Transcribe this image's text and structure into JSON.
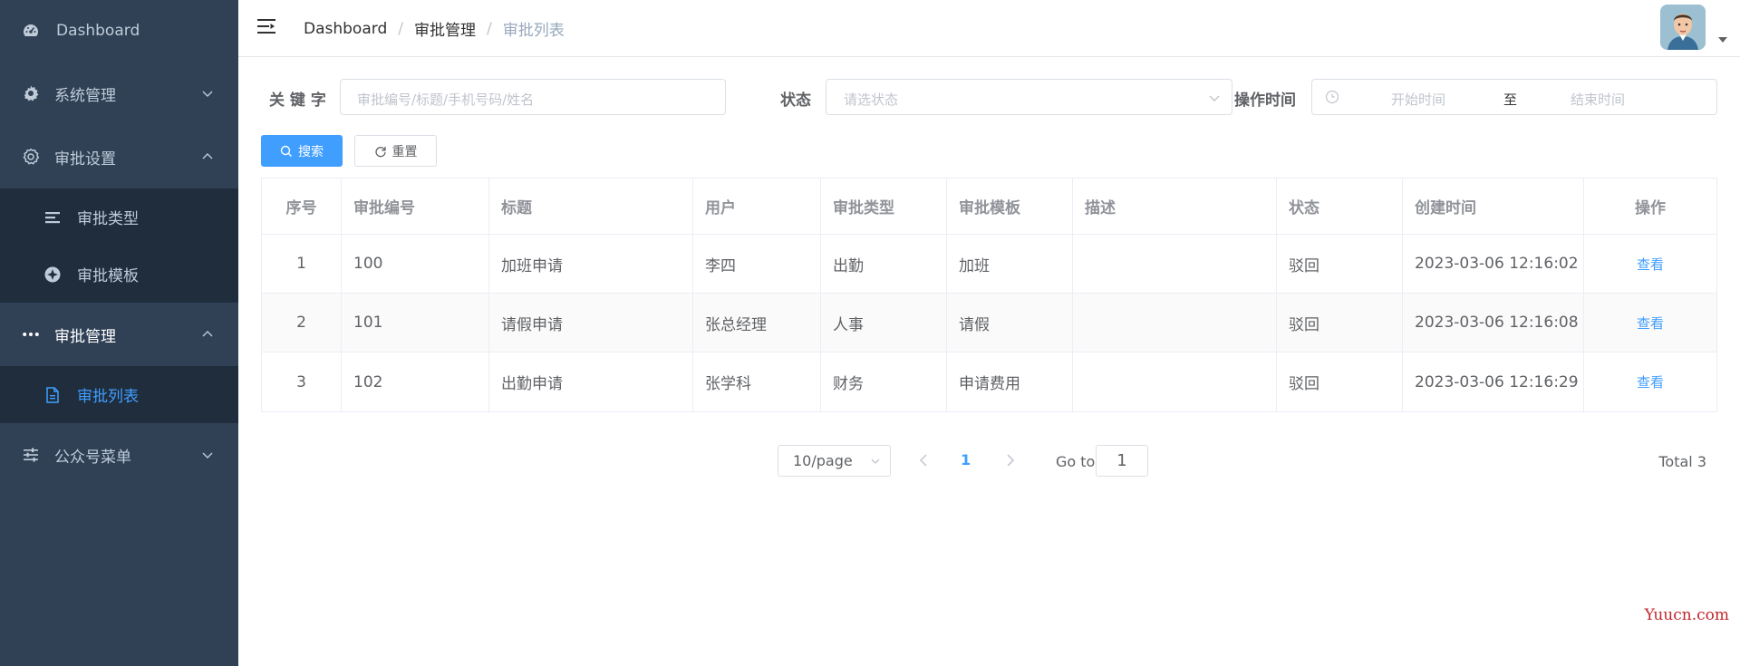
{
  "sidebar": {
    "items": [
      {
        "label": "Dashboard",
        "icon": "dashboard-icon"
      },
      {
        "label": "系统管理",
        "icon": "gear-icon"
      },
      {
        "label": "审批设置",
        "icon": "settings-icon"
      },
      {
        "label": "审批类型",
        "icon": "list-icon"
      },
      {
        "label": "审批模板",
        "icon": "template-icon"
      },
      {
        "label": "审批管理",
        "icon": "more-icon"
      },
      {
        "label": "审批列表",
        "icon": "document-icon"
      },
      {
        "label": "公众号菜单",
        "icon": "sliders-icon"
      }
    ],
    "bg_color": "#304156",
    "sub_bg_color": "#1f2d3d",
    "active_color": "#409eff"
  },
  "header": {
    "breadcrumb": [
      "Dashboard",
      "审批管理",
      "审批列表"
    ],
    "separator": "/"
  },
  "filters": {
    "keyword_label": "关 键 字",
    "keyword_placeholder": "审批编号/标题/手机号码/姓名",
    "status_label": "状态",
    "status_placeholder": "请选状态",
    "time_label": "操作时间",
    "start_placeholder": "开始时间",
    "range_sep": "至",
    "end_placeholder": "结束时间"
  },
  "buttons": {
    "search": "搜索",
    "reset": "重置"
  },
  "table": {
    "columns": [
      "序号",
      "审批编号",
      "标题",
      "用户",
      "审批类型",
      "审批模板",
      "描述",
      "状态",
      "创建时间",
      "操作"
    ],
    "rows": [
      [
        "1",
        "100",
        "加班申请",
        "李四",
        "出勤",
        "加班",
        "",
        "驳回",
        "2023-03-06 12:16:02",
        "查看"
      ],
      [
        "2",
        "101",
        "请假申请",
        "张总经理",
        "人事",
        "请假",
        "",
        "驳回",
        "2023-03-06 12:16:08",
        "查看"
      ],
      [
        "3",
        "102",
        "出勤申请",
        "张学科",
        "财务",
        "申请费用",
        "",
        "驳回",
        "2023-03-06 12:16:29",
        "查看"
      ]
    ]
  },
  "pagination": {
    "page_size": "10/page",
    "current_page": "1",
    "goto_label": "Go to",
    "goto_value": "1",
    "total": "Total 3"
  },
  "watermark": "Yuucn.com"
}
